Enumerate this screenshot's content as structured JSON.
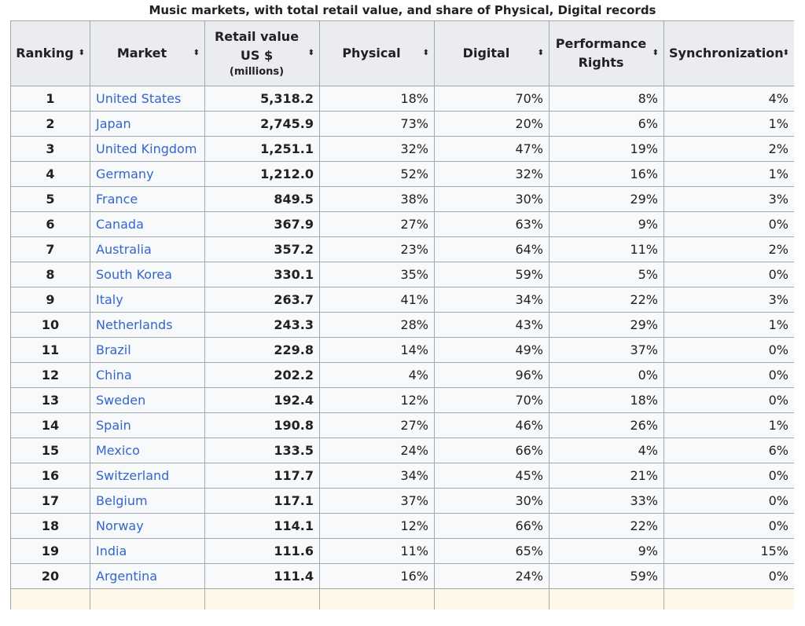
{
  "caption": "Music markets, with total retail value, and share of Physical, Digital records",
  "headers": {
    "ranking": "Ranking",
    "market": "Market",
    "retail_line1": "Retail value",
    "retail_line2": "US $",
    "retail_line3": "(millions)",
    "physical": "Physical",
    "digital": "Digital",
    "performance_line1": "Performance",
    "performance_line2": "Rights",
    "synchronization": "Synchronization",
    "sort_glyph": "⬍"
  },
  "rows": [
    {
      "rank": "1",
      "market": "United States",
      "value": "5,318.2",
      "physical": "18%",
      "digital": "70%",
      "performance": "8%",
      "sync": "4%"
    },
    {
      "rank": "2",
      "market": "Japan",
      "value": "2,745.9",
      "physical": "73%",
      "digital": "20%",
      "performance": "6%",
      "sync": "1%"
    },
    {
      "rank": "3",
      "market": "United Kingdom",
      "value": "1,251.1",
      "physical": "32%",
      "digital": "47%",
      "performance": "19%",
      "sync": "2%"
    },
    {
      "rank": "4",
      "market": "Germany",
      "value": "1,212.0",
      "physical": "52%",
      "digital": "32%",
      "performance": "16%",
      "sync": "1%"
    },
    {
      "rank": "5",
      "market": "France",
      "value": "849.5",
      "physical": "38%",
      "digital": "30%",
      "performance": "29%",
      "sync": "3%"
    },
    {
      "rank": "6",
      "market": "Canada",
      "value": "367.9",
      "physical": "27%",
      "digital": "63%",
      "performance": "9%",
      "sync": "0%"
    },
    {
      "rank": "7",
      "market": "Australia",
      "value": "357.2",
      "physical": "23%",
      "digital": "64%",
      "performance": "11%",
      "sync": "2%"
    },
    {
      "rank": "8",
      "market": "South Korea",
      "value": "330.1",
      "physical": "35%",
      "digital": "59%",
      "performance": "5%",
      "sync": "0%"
    },
    {
      "rank": "9",
      "market": "Italy",
      "value": "263.7",
      "physical": "41%",
      "digital": "34%",
      "performance": "22%",
      "sync": "3%"
    },
    {
      "rank": "10",
      "market": "Netherlands",
      "value": "243.3",
      "physical": "28%",
      "digital": "43%",
      "performance": "29%",
      "sync": "1%"
    },
    {
      "rank": "11",
      "market": "Brazil",
      "value": "229.8",
      "physical": "14%",
      "digital": "49%",
      "performance": "37%",
      "sync": "0%"
    },
    {
      "rank": "12",
      "market": "China",
      "value": "202.2",
      "physical": "4%",
      "digital": "96%",
      "performance": "0%",
      "sync": "0%"
    },
    {
      "rank": "13",
      "market": "Sweden",
      "value": "192.4",
      "physical": "12%",
      "digital": "70%",
      "performance": "18%",
      "sync": "0%"
    },
    {
      "rank": "14",
      "market": "Spain",
      "value": "190.8",
      "physical": "27%",
      "digital": "46%",
      "performance": "26%",
      "sync": "1%"
    },
    {
      "rank": "15",
      "market": "Mexico",
      "value": "133.5",
      "physical": "24%",
      "digital": "66%",
      "performance": "4%",
      "sync": "6%"
    },
    {
      "rank": "16",
      "market": "Switzerland",
      "value": "117.7",
      "physical": "34%",
      "digital": "45%",
      "performance": "21%",
      "sync": "0%"
    },
    {
      "rank": "17",
      "market": "Belgium",
      "value": "117.1",
      "physical": "37%",
      "digital": "30%",
      "performance": "33%",
      "sync": "0%"
    },
    {
      "rank": "18",
      "market": "Norway",
      "value": "114.1",
      "physical": "12%",
      "digital": "66%",
      "performance": "22%",
      "sync": "0%"
    },
    {
      "rank": "19",
      "market": "India",
      "value": "111.6",
      "physical": "11%",
      "digital": "65%",
      "performance": "9%",
      "sync": "15%"
    },
    {
      "rank": "20",
      "market": "Argentina",
      "value": "111.4",
      "physical": "16%",
      "digital": "24%",
      "performance": "59%",
      "sync": "0%"
    }
  ]
}
